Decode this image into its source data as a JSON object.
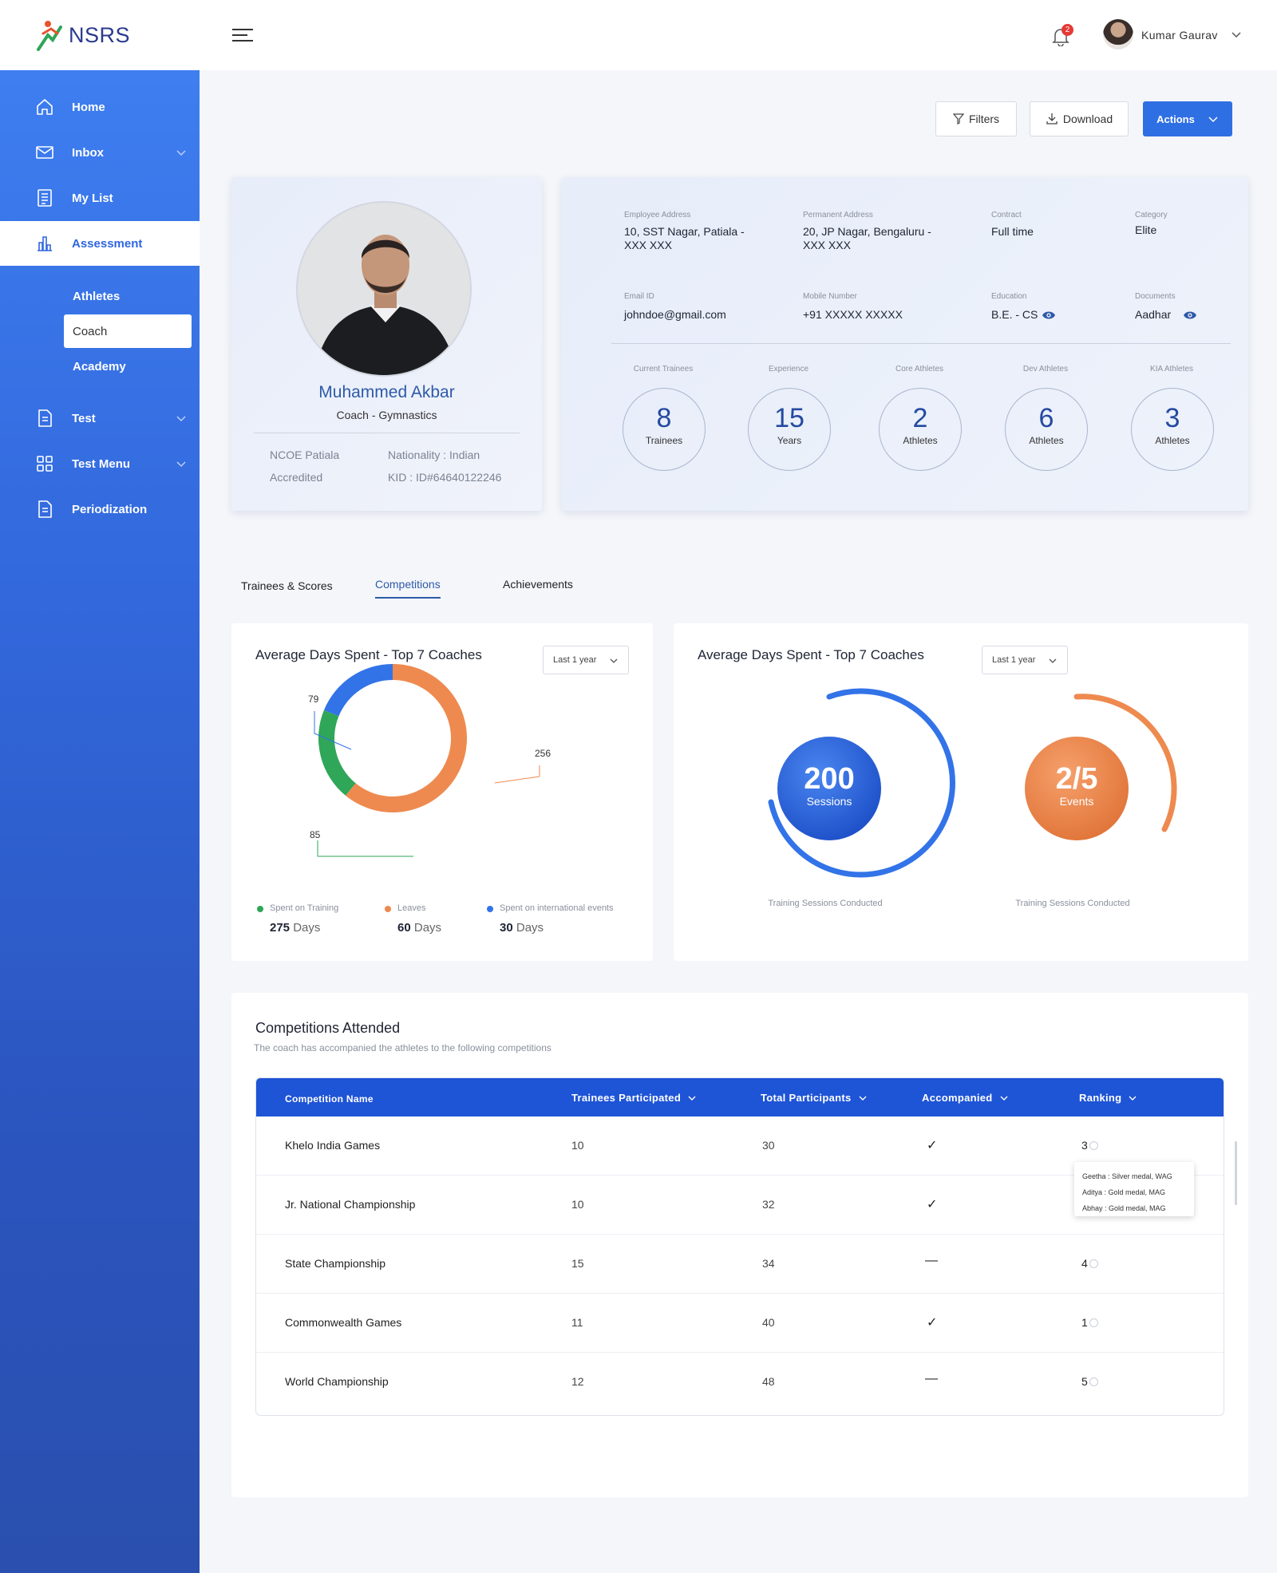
{
  "app": {
    "logo_text": "NSRS"
  },
  "sidebar": {
    "items": [
      {
        "label": "Home"
      },
      {
        "label": "Inbox"
      },
      {
        "label": "My List"
      },
      {
        "label": "Assessment"
      },
      {
        "label": "Test"
      },
      {
        "label": "Test Menu"
      },
      {
        "label": "Periodization"
      }
    ],
    "sub_items": [
      {
        "label": "Athletes"
      },
      {
        "label": "Coach"
      },
      {
        "label": "Academy"
      }
    ]
  },
  "header": {
    "notification_count": "2",
    "user_name": "Kumar Gaurav"
  },
  "actions": {
    "filters": "Filters",
    "download": "Download",
    "actions": "Actions"
  },
  "profile": {
    "name": "Muhammed Akbar",
    "role": "Coach - Gymnastics",
    "org": "NCOE Patiala",
    "nationality": "Nationality : Indian",
    "status": "Accredited",
    "kid": "KID : ID#64640122246"
  },
  "info": {
    "employee_address_label": "Employee Address",
    "employee_address": "10, SST Nagar, Patiala - XXX XXX",
    "permanent_address_label": "Permanent Address",
    "permanent_address": "20, JP Nagar, Bengaluru - XXX XXX",
    "contract_label": "Contract",
    "contract": "Full time",
    "category_label": "Category",
    "category": "Elite",
    "email_label": "Email ID",
    "email": "johndoe@gmail.com",
    "mobile_label": "Mobile Number",
    "mobile": "+91 XXXXX XXXXX",
    "education_label": "Education",
    "education": "B.E. - CS",
    "documents_label": "Documents",
    "documents": "Aadhar"
  },
  "stats": [
    {
      "label": "Current Trainees",
      "value": "8",
      "unit": "Trainees"
    },
    {
      "label": "Experience",
      "value": "15",
      "unit": "Years"
    },
    {
      "label": "Core Athletes",
      "value": "2",
      "unit": "Athletes"
    },
    {
      "label": "Dev Athletes",
      "value": "6",
      "unit": "Athletes"
    },
    {
      "label": "KIA Athletes",
      "value": "3",
      "unit": "Athletes"
    }
  ],
  "tabs": [
    {
      "label": "Trainees & Scores"
    },
    {
      "label": "Competitions"
    },
    {
      "label": "Achievements"
    }
  ],
  "charts": {
    "donut_title": "Average Days Spent - Top 7 Coaches",
    "gauge_title": "Average Days Spent - Top 7 Coaches",
    "period": "Last 1 year",
    "legend": [
      {
        "label": "Spent on Training",
        "value": "275",
        "unit": "Days",
        "color": "#2fa658"
      },
      {
        "label": "Leaves",
        "value": "60",
        "unit": "Days",
        "color": "#ee8a4f"
      },
      {
        "label": "Spent on international events",
        "value": "30",
        "unit": "Days",
        "color": "#3273e8"
      }
    ],
    "callouts": {
      "orange": "256",
      "blue": "79",
      "green": "85"
    },
    "gauge1": {
      "value": "200",
      "unit": "Sessions",
      "caption": "Training Sessions Conducted"
    },
    "gauge2": {
      "value": "2/5",
      "unit": "Events",
      "caption": "Training Sessions Conducted"
    }
  },
  "chart_data": {
    "type": "pie",
    "categories": [
      "Leaves",
      "Spent on Training",
      "Spent on international events"
    ],
    "values": [
      256,
      85,
      79
    ],
    "colors": [
      "#ee8a4f",
      "#2fa658",
      "#3273e8"
    ]
  },
  "competitions": {
    "title": "Competitions Attended",
    "subtitle": "The coach has accompanied the athletes to the following competitions",
    "columns": [
      "Competition Name",
      "Trainees Participated",
      "Total Participants",
      "Accompanied",
      "Ranking"
    ],
    "rows": [
      {
        "name": "Khelo India Games",
        "trainees": "10",
        "total": "30",
        "accompanied": "✓",
        "ranking": "3"
      },
      {
        "name": "Jr. National Championship",
        "trainees": "10",
        "total": "32",
        "accompanied": "✓",
        "ranking": ""
      },
      {
        "name": "State Championship",
        "trainees": "15",
        "total": "34",
        "accompanied": "—",
        "ranking": "4"
      },
      {
        "name": "Commonwealth Games",
        "trainees": "11",
        "total": "40",
        "accompanied": "✓",
        "ranking": "1"
      },
      {
        "name": "World Championship",
        "trainees": "12",
        "total": "48",
        "accompanied": "—",
        "ranking": "5"
      }
    ],
    "tooltip": [
      "Geetha : Silver medal, WAG",
      "Aditya : Gold medal, MAG",
      "Abhay : Gold medal, MAG"
    ]
  }
}
